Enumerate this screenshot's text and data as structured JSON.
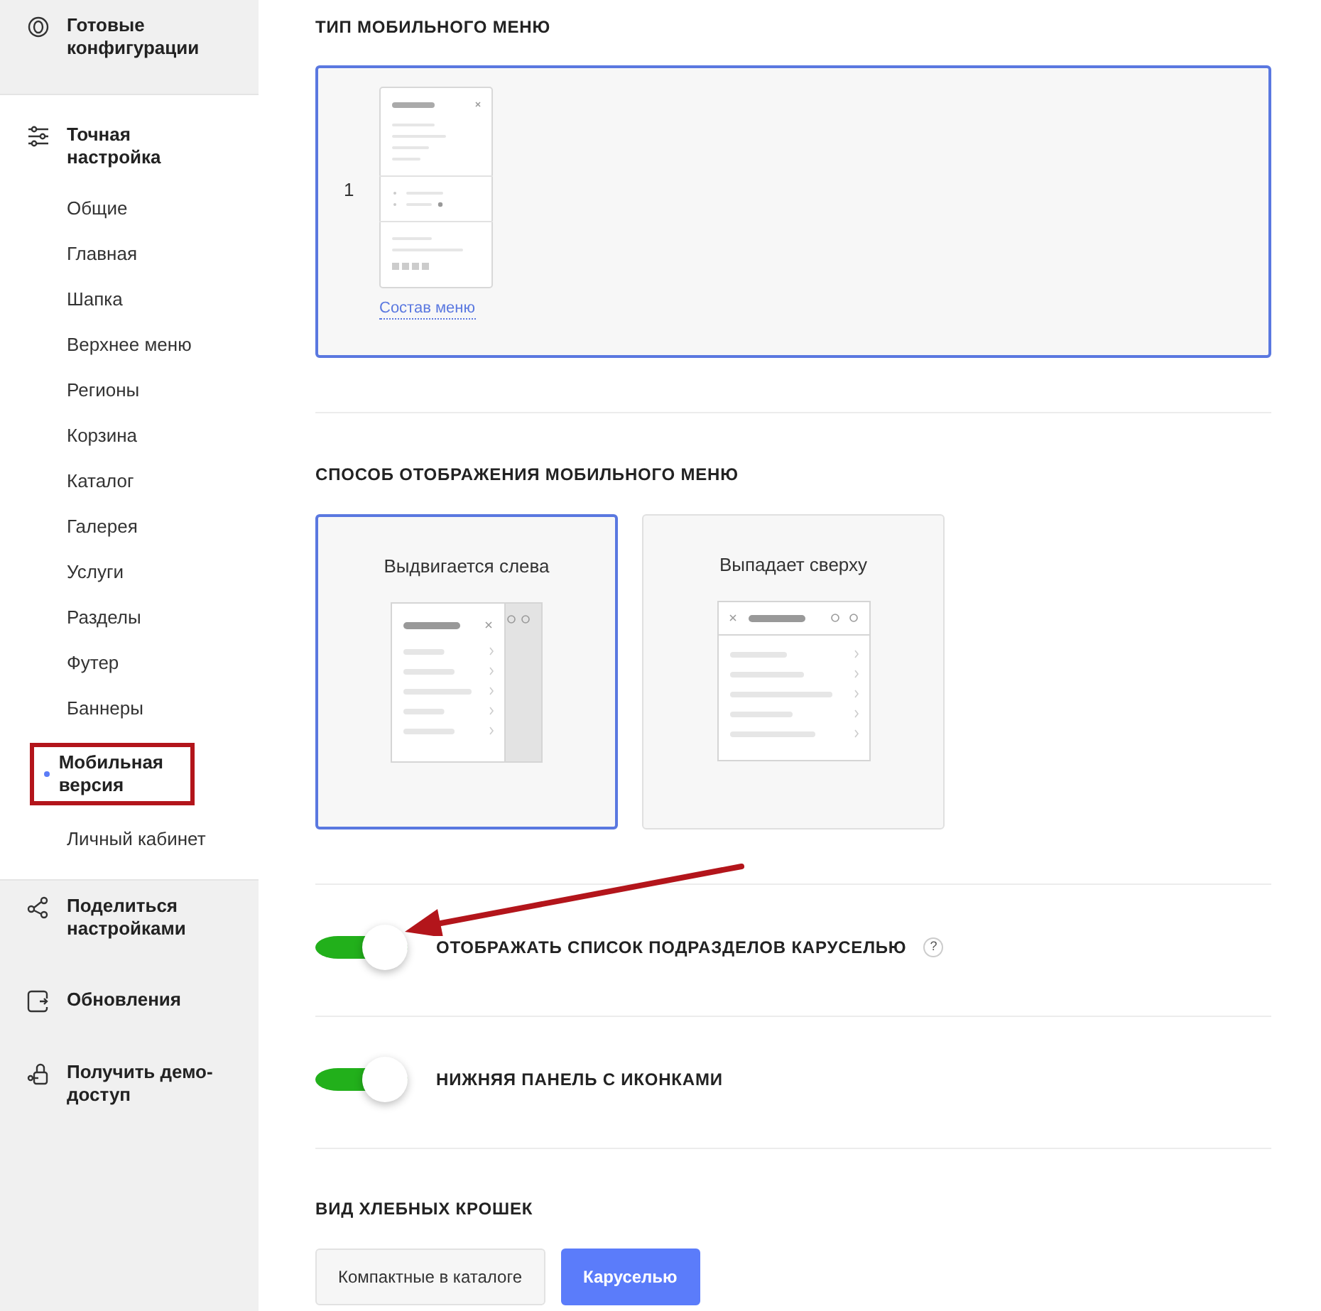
{
  "sidebar": {
    "groups": [
      {
        "label": "Готовые конфигурации",
        "expanded": false
      },
      {
        "label": "Точная настройка",
        "expanded": true,
        "children": [
          {
            "label": "Общие",
            "selected": false,
            "highlighted": false
          },
          {
            "label": "Главная",
            "selected": false,
            "highlighted": false
          },
          {
            "label": "Шапка",
            "selected": false,
            "highlighted": false
          },
          {
            "label": "Верхнее меню",
            "selected": false,
            "highlighted": false
          },
          {
            "label": "Регионы",
            "selected": false,
            "highlighted": false
          },
          {
            "label": "Корзина",
            "selected": false,
            "highlighted": false
          },
          {
            "label": "Каталог",
            "selected": false,
            "highlighted": false
          },
          {
            "label": "Галерея",
            "selected": false,
            "highlighted": false
          },
          {
            "label": "Услуги",
            "selected": false,
            "highlighted": false
          },
          {
            "label": "Разделы",
            "selected": false,
            "highlighted": false
          },
          {
            "label": "Футер",
            "selected": false,
            "highlighted": false
          },
          {
            "label": "Баннеры",
            "selected": false,
            "highlighted": false
          },
          {
            "label": "Мобильная версия",
            "selected": true,
            "highlighted": true
          },
          {
            "label": "Личный кабинет",
            "selected": false,
            "highlighted": false
          }
        ]
      },
      {
        "label": "Поделиться настройками",
        "expanded": false
      },
      {
        "label": "Обновления",
        "expanded": false
      },
      {
        "label": "Получить демо-доступ",
        "expanded": false
      }
    ]
  },
  "menu_type": {
    "title": "ТИП МОБИЛЬНОГО МЕНЮ",
    "options": [
      {
        "number": "1",
        "link": "Состав меню",
        "selected": true
      }
    ]
  },
  "display_mode": {
    "title": "СПОСОБ ОТОБРАЖЕНИЯ МОБИЛЬНОГО МЕНЮ",
    "options": [
      {
        "label": "Выдвигается слева",
        "kind": "slide",
        "selected": true
      },
      {
        "label": "Выпадает сверху",
        "kind": "drop",
        "selected": false
      }
    ]
  },
  "toggles": [
    {
      "label": "ОТОБРАЖАТЬ СПИСОК ПОДРАЗДЕЛОВ КАРУСЕЛЬЮ",
      "on": true,
      "help": "?",
      "pointed": true
    },
    {
      "label": "НИЖНЯЯ ПАНЕЛЬ С ИКОНКАМИ",
      "on": true,
      "pointed": false
    }
  ],
  "breadcrumbs": {
    "title": "ВИД ХЛЕБНЫХ КРОШЕК",
    "options": [
      {
        "label": "Компактные в каталоге",
        "selected": false
      },
      {
        "label": "Каруселью",
        "selected": true
      }
    ]
  }
}
